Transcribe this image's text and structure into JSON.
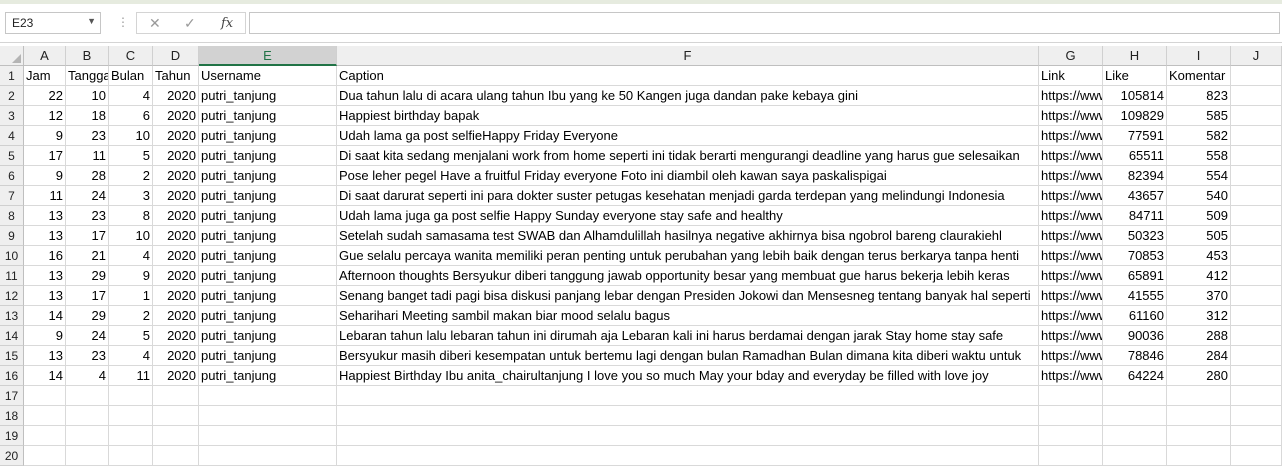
{
  "name_box": "E23",
  "formula_bar": {
    "cancel_icon": "✕",
    "enter_icon": "✓",
    "fx_label": "fx",
    "value": ""
  },
  "columns": [
    "A",
    "B",
    "C",
    "D",
    "E",
    "F",
    "G",
    "H",
    "I",
    "J"
  ],
  "row_numbers": [
    "1",
    "2",
    "3",
    "4",
    "5",
    "6",
    "7",
    "8",
    "9",
    "10",
    "11",
    "12",
    "13",
    "14",
    "15",
    "16",
    "17",
    "18",
    "19",
    "20"
  ],
  "header_row": [
    "Jam",
    "Tanggal",
    "Bulan",
    "Tahun",
    "Username",
    "Caption",
    "Link",
    "Like",
    "Komentar"
  ],
  "data_rows": [
    [
      "22",
      "10",
      "4",
      "2020",
      "putri_tanjung",
      "Dua tahun lalu di acara ulang tahun Ibu yang ke 50 Kangen juga dandan pake kebaya gini",
      "https://www",
      "105814",
      "823"
    ],
    [
      "12",
      "18",
      "6",
      "2020",
      "putri_tanjung",
      "Happiest birthday bapak",
      "https://www",
      "109829",
      "585"
    ],
    [
      "9",
      "23",
      "10",
      "2020",
      "putri_tanjung",
      "Udah lama ga post selfieHappy Friday Everyone",
      "https://www",
      "77591",
      "582"
    ],
    [
      "17",
      "11",
      "5",
      "2020",
      "putri_tanjung",
      "Di saat kita sedang menjalani work from home seperti ini tidak berarti mengurangi deadline yang harus gue selesaikan",
      "https://www",
      "65511",
      "558"
    ],
    [
      "9",
      "28",
      "2",
      "2020",
      "putri_tanjung",
      "Pose leher pegel  Have a fruitful Friday everyone  Foto ini diambil oleh kawan saya paskalispigai",
      "https://www",
      "82394",
      "554"
    ],
    [
      "11",
      "24",
      "3",
      "2020",
      "putri_tanjung",
      "Di saat darurat seperti ini para dokter suster  petugas kesehatan menjadi garda terdepan yang melindungi Indonesia",
      "https://www",
      "43657",
      "540"
    ],
    [
      "13",
      "23",
      "8",
      "2020",
      "putri_tanjung",
      "Udah lama juga ga post selfie Happy Sunday everyone stay safe and healthy",
      "https://www",
      "84711",
      "509"
    ],
    [
      "13",
      "17",
      "10",
      "2020",
      "putri_tanjung",
      "Setelah sudah samasama test SWAB dan Alhamdulillah hasilnya negative akhirnya bisa ngobrol bareng claurakiehl",
      "https://www",
      "50323",
      "505"
    ],
    [
      "16",
      "21",
      "4",
      "2020",
      "putri_tanjung",
      "Gue selalu percaya wanita memiliki peran penting untuk perubahan yang lebih baik dengan terus berkarya tanpa henti",
      "https://www",
      "70853",
      "453"
    ],
    [
      "13",
      "29",
      "9",
      "2020",
      "putri_tanjung",
      "Afternoon thoughts Bersyukur diberi tanggung jawab  opportunity besar yang membuat gue harus bekerja lebih keras",
      "https://www",
      "65891",
      "412"
    ],
    [
      "13",
      "17",
      "1",
      "2020",
      "putri_tanjung",
      "Senang banget tadi pagi bisa diskusi panjang lebar dengan Presiden Jokowi dan Mensesneg tentang banyak hal seperti",
      "https://www",
      "41555",
      "370"
    ],
    [
      "14",
      "29",
      "2",
      "2020",
      "putri_tanjung",
      "Seharihari Meeting sambil makan biar mood selalu bagus",
      "https://www",
      "61160",
      "312"
    ],
    [
      "9",
      "24",
      "5",
      "2020",
      "putri_tanjung",
      "Lebaran tahun lalu lebaran tahun ini dirumah aja Lebaran kali ini harus berdamai dengan jarak Stay home stay safe",
      "https://www",
      "90036",
      "288"
    ],
    [
      "13",
      "23",
      "4",
      "2020",
      "putri_tanjung",
      "Bersyukur masih diberi kesempatan untuk bertemu lagi dengan bulan Ramadhan Bulan dimana kita diberi waktu untuk",
      "https://www",
      "78846",
      "284"
    ],
    [
      "14",
      "4",
      "11",
      "2020",
      "putri_tanjung",
      "Happiest Birthday Ibu  anita_chairultanjung  I love you so much May your bday and everyday be filled with love joy",
      "https://www",
      "64224",
      "280"
    ]
  ],
  "colors": {
    "accent": "#217346",
    "header_bg": "#efefef",
    "grid_line": "#d9d9d9"
  }
}
